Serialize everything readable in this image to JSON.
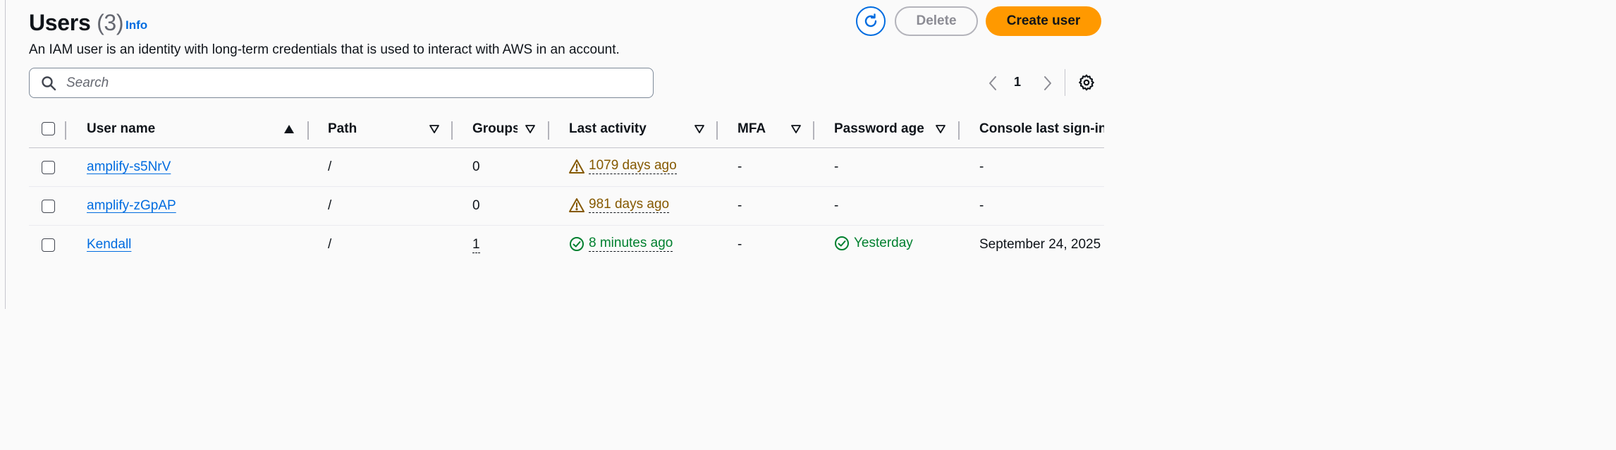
{
  "page": {
    "title": "Users",
    "count": "(3)",
    "info_link": "Info",
    "description": "An IAM user is an identity with long-term credentials that is used to interact with AWS in an account."
  },
  "actions": {
    "refresh_icon": "refresh-icon",
    "delete_label": "Delete",
    "create_label": "Create user",
    "accent_color": "#006ce0",
    "primary_color": "#ff9900"
  },
  "search": {
    "placeholder": "Search",
    "value": "",
    "icon": "search-icon"
  },
  "pagination": {
    "current_page": "1",
    "prev_icon": "chevron-left-icon",
    "next_icon": "chevron-right-icon",
    "settings_icon": "gear-icon"
  },
  "table": {
    "columns": [
      "User name",
      "Path",
      "Groups",
      "Last activity",
      "MFA",
      "Password age",
      "Console last sign-in"
    ],
    "sorted_column": "User name",
    "sort_direction": "ascending",
    "rows": [
      {
        "user_name": "amplify-s5NrV",
        "path": "/",
        "groups": "0",
        "last_activity": "1079 days ago",
        "last_activity_status": "warning",
        "mfa": "-",
        "password_age": "-",
        "password_status": "none",
        "console_last_signin": "-"
      },
      {
        "user_name": "amplify-zGpAP",
        "path": "/",
        "groups": "0",
        "last_activity": "981 days ago",
        "last_activity_status": "warning",
        "mfa": "-",
        "password_age": "-",
        "password_status": "none",
        "console_last_signin": "-"
      },
      {
        "user_name": "Kendall",
        "path": "/",
        "groups": "1",
        "last_activity": "8 minutes ago",
        "last_activity_status": "success",
        "mfa": "-",
        "password_age": "Yesterday",
        "password_status": "success",
        "console_last_signin": "September 24, 2025"
      }
    ],
    "warning_color": "#855900",
    "success_color": "#00802f"
  }
}
